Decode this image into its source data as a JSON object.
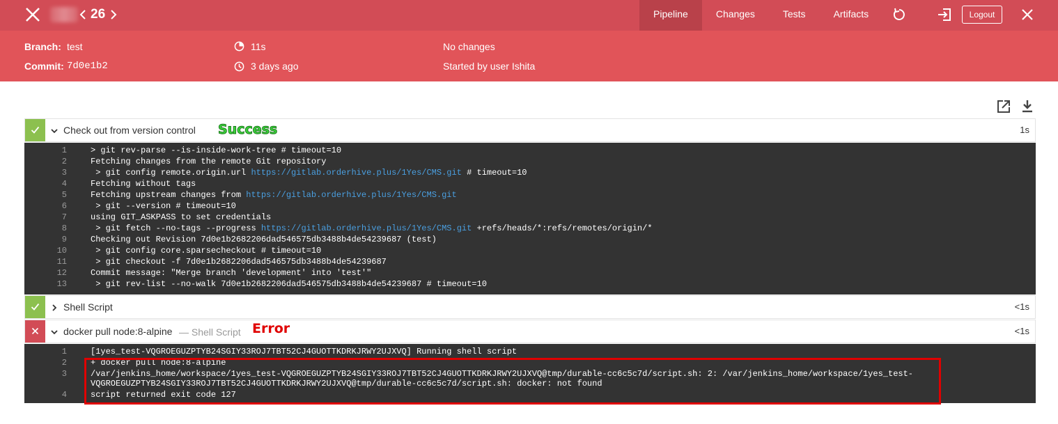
{
  "header": {
    "run_number": "26",
    "tabs": [
      "Pipeline",
      "Changes",
      "Tests",
      "Artifacts"
    ],
    "active_tab": "Pipeline",
    "logout_label": "Logout",
    "bar_color": "#d24c56"
  },
  "summary": {
    "branch_label": "Branch:",
    "branch_value": "test",
    "commit_label": "Commit:",
    "commit_value": "7d0e1b2",
    "duration": "11s",
    "time_ago": "3 days ago",
    "changes": "No changes",
    "started_by": "Started by user Ishita",
    "bg_color": "#e15459"
  },
  "stages": [
    {
      "status": "success",
      "title": "Check out from version control",
      "duration": "1s",
      "expanded": true,
      "lines": [
        {
          "n": "1",
          "text": "> git rev-parse --is-inside-work-tree # timeout=10"
        },
        {
          "n": "2",
          "text": "Fetching changes from the remote Git repository"
        },
        {
          "n": "3",
          "pre": " > git config remote.origin.url ",
          "link": "https://gitlab.orderhive.plus/1Yes/CMS.git",
          "post": " # timeout=10"
        },
        {
          "n": "4",
          "text": "Fetching without tags"
        },
        {
          "n": "5",
          "pre": "Fetching upstream changes from ",
          "link": "https://gitlab.orderhive.plus/1Yes/CMS.git",
          "post": ""
        },
        {
          "n": "6",
          "text": " > git --version # timeout=10"
        },
        {
          "n": "7",
          "text": "using GIT_ASKPASS to set credentials"
        },
        {
          "n": "8",
          "pre": " > git fetch --no-tags --progress ",
          "link": "https://gitlab.orderhive.plus/1Yes/CMS.git",
          "post": " +refs/heads/*:refs/remotes/origin/*"
        },
        {
          "n": "9",
          "text": "Checking out Revision 7d0e1b2682206dad546575db3488b4de54239687 (test)"
        },
        {
          "n": "10",
          "text": " > git config core.sparsecheckout # timeout=10"
        },
        {
          "n": "11",
          "text": " > git checkout -f 7d0e1b2682206dad546575db3488b4de54239687"
        },
        {
          "n": "12",
          "text": "Commit message: \"Merge branch 'development' into 'test'\""
        },
        {
          "n": "13",
          "text": " > git rev-list --no-walk 7d0e1b2682206dad546575db3488b4de54239687 # timeout=10"
        }
      ]
    },
    {
      "status": "success",
      "title": "Shell Script",
      "duration": "<1s",
      "expanded": false
    },
    {
      "status": "error",
      "title": "docker pull node:8-alpine",
      "subtitle": "— Shell Script",
      "duration": "<1s",
      "expanded": true,
      "lines": [
        {
          "n": "1",
          "text": "[1yes_test-VQGROEGUZPTYB24SGIY33ROJ7TBT52CJ4GUOTTKDRKJRWY2UJXVQ] Running shell script"
        },
        {
          "n": "2",
          "text": "+ docker pull node:8-alpine"
        },
        {
          "n": "3",
          "text": "/var/jenkins_home/workspace/1yes_test-VQGROEGUZPTYB24SGIY33ROJ7TBT52CJ4GUOTTKDRKJRWY2UJXVQ@tmp/durable-cc6c5c7d/script.sh: 2: /var/jenkins_home/workspace/1yes_test-",
          "text2": "VQGROEGUZPTYB24SGIY33ROJ7TBT52CJ4GUOTTKDRKJRWY2UJXVQ@tmp/durable-cc6c5c7d/script.sh: docker: not found"
        },
        {
          "n": "4",
          "text": "script returned exit code 127"
        }
      ]
    }
  ],
  "annotations": {
    "success_label": "Success",
    "error_label": "Error",
    "success_color": "#3bd43b",
    "error_color": "#e00000"
  },
  "icons": [
    "close-icon",
    "chevron-left-icon",
    "chevron-right-icon",
    "replay-icon",
    "exit-icon",
    "clock-half-icon",
    "clock-icon",
    "open-external-icon",
    "download-icon",
    "check-icon",
    "x-icon",
    "chevron-down-icon",
    "chevron-right-icon"
  ]
}
